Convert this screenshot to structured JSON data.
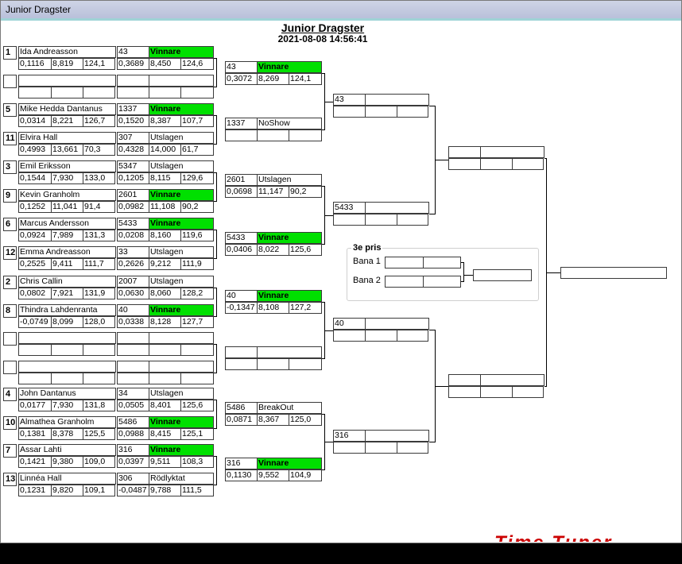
{
  "window": {
    "title": "Junior Dragster"
  },
  "header": {
    "title": "Junior Dragster",
    "datetime": "2021-08-08 14:56:41"
  },
  "round1": [
    {
      "seed": "1",
      "name": "Ida Andreasson",
      "stats": [
        "0,1116",
        "8,819",
        "124,1"
      ],
      "rt": "43",
      "result": "Vinnare",
      "win": true,
      "rstats": [
        "0,3689",
        "8,450",
        "124,6"
      ]
    },
    {
      "seed": "",
      "name": "",
      "stats": [
        "",
        "",
        ""
      ],
      "rt": "",
      "result": "",
      "win": false,
      "rstats": [
        "",
        "",
        ""
      ]
    },
    {
      "seed": "5",
      "name": "Mike Hedda Dantanus",
      "stats": [
        "0,0314",
        "8,221",
        "126,7"
      ],
      "rt": "1337",
      "result": "Vinnare",
      "win": true,
      "rstats": [
        "0,1520",
        "8,387",
        "107,7"
      ]
    },
    {
      "seed": "11",
      "name": "Elvira Hall",
      "stats": [
        "0,4993",
        "13,661",
        "70,3"
      ],
      "rt": "307",
      "result": "Utslagen",
      "win": false,
      "rstats": [
        "0,4328",
        "14,000",
        "61,7"
      ]
    },
    {
      "seed": "3",
      "name": "Emil Eriksson",
      "stats": [
        "0,1544",
        "7,930",
        "133,0"
      ],
      "rt": "5347",
      "result": "Utslagen",
      "win": false,
      "rstats": [
        "0,1205",
        "8,115",
        "129,6"
      ]
    },
    {
      "seed": "9",
      "name": "Kevin Granholm",
      "stats": [
        "0,1252",
        "11,041",
        "91,4"
      ],
      "rt": "2601",
      "result": "Vinnare",
      "win": true,
      "rstats": [
        "0,0982",
        "11,108",
        "90,2"
      ]
    },
    {
      "seed": "6",
      "name": "Marcus Andersson",
      "stats": [
        "0,0924",
        "7,989",
        "131,3"
      ],
      "rt": "5433",
      "result": "Vinnare",
      "win": true,
      "rstats": [
        "0,0208",
        "8,160",
        "119,6"
      ]
    },
    {
      "seed": "12",
      "name": "Emma Andreasson",
      "stats": [
        "0,2525",
        "9,411",
        "111,7"
      ],
      "rt": "33",
      "result": "Utslagen",
      "win": false,
      "rstats": [
        "0,2626",
        "9,212",
        "111,9"
      ]
    },
    {
      "seed": "2",
      "name": "Chris Callin",
      "stats": [
        "0,0802",
        "7,921",
        "131,9"
      ],
      "rt": "2007",
      "result": "Utslagen",
      "win": false,
      "rstats": [
        "0,0630",
        "8,060",
        "128,2"
      ]
    },
    {
      "seed": "8",
      "name": "Thindra Lahdenranta",
      "stats": [
        "-0,0749",
        "8,099",
        "128,0"
      ],
      "rt": "40",
      "result": "Vinnare",
      "win": true,
      "rstats": [
        "0,0338",
        "8,128",
        "127,7"
      ]
    },
    {
      "seed": "",
      "name": "",
      "stats": [
        "",
        "",
        ""
      ],
      "rt": "",
      "result": "",
      "win": false,
      "rstats": [
        "",
        "",
        ""
      ]
    },
    {
      "seed": "",
      "name": "",
      "stats": [
        "",
        "",
        ""
      ],
      "rt": "",
      "result": "",
      "win": false,
      "rstats": [
        "",
        "",
        ""
      ]
    },
    {
      "seed": "4",
      "name": "John Dantanus",
      "stats": [
        "0,0177",
        "7,930",
        "131,8"
      ],
      "rt": "34",
      "result": "Utslagen",
      "win": false,
      "rstats": [
        "0,0505",
        "8,401",
        "125,6"
      ]
    },
    {
      "seed": "10",
      "name": "Almathea Granholm",
      "stats": [
        "0,1381",
        "8,378",
        "125,5"
      ],
      "rt": "5486",
      "result": "Vinnare",
      "win": true,
      "rstats": [
        "0,0988",
        "8,415",
        "125,1"
      ]
    },
    {
      "seed": "7",
      "name": "Assar Lahti",
      "stats": [
        "0,1421",
        "9,380",
        "109,0"
      ],
      "rt": "316",
      "result": "Vinnare",
      "win": true,
      "rstats": [
        "0,0397",
        "9,511",
        "108,3"
      ]
    },
    {
      "seed": "13",
      "name": "Linnéa Hall",
      "stats": [
        "0,1231",
        "9,820",
        "109,1"
      ],
      "rt": "306",
      "result": "Rödlyktat",
      "win": false,
      "rstats": [
        "-0,0487",
        "9,788",
        "111,5"
      ]
    }
  ],
  "round2": [
    {
      "num": "43",
      "result": "Vinnare",
      "win": true,
      "stats": [
        "0,3072",
        "8,269",
        "124,1"
      ]
    },
    {
      "num": "1337",
      "result": "NoShow",
      "win": false,
      "stats": [
        "",
        "",
        ""
      ]
    },
    {
      "num": "2601",
      "result": "Utslagen",
      "win": false,
      "stats": [
        "0,0698",
        "11,147",
        "90,2"
      ]
    },
    {
      "num": "5433",
      "result": "Vinnare",
      "win": true,
      "stats": [
        "0,0406",
        "8,022",
        "125,6"
      ]
    },
    {
      "num": "40",
      "result": "Vinnare",
      "win": true,
      "stats": [
        "-0,1347",
        "8,108",
        "127,2"
      ]
    },
    {
      "num": "",
      "result": "",
      "win": false,
      "stats": [
        "",
        "",
        ""
      ]
    },
    {
      "num": "5486",
      "result": "BreakOut",
      "win": false,
      "stats": [
        "0,0871",
        "8,367",
        "125,0"
      ]
    },
    {
      "num": "316",
      "result": "Vinnare",
      "win": true,
      "stats": [
        "0,1130",
        "9,552",
        "104,9"
      ]
    }
  ],
  "round3": [
    {
      "num": "43"
    },
    {
      "num": "5433"
    },
    {
      "num": "40"
    },
    {
      "num": "316"
    }
  ],
  "third_place": {
    "label": "3e pris",
    "lane1": "Bana 1",
    "lane2": "Bana 2"
  },
  "logo": {
    "text": "Time Tuner"
  }
}
